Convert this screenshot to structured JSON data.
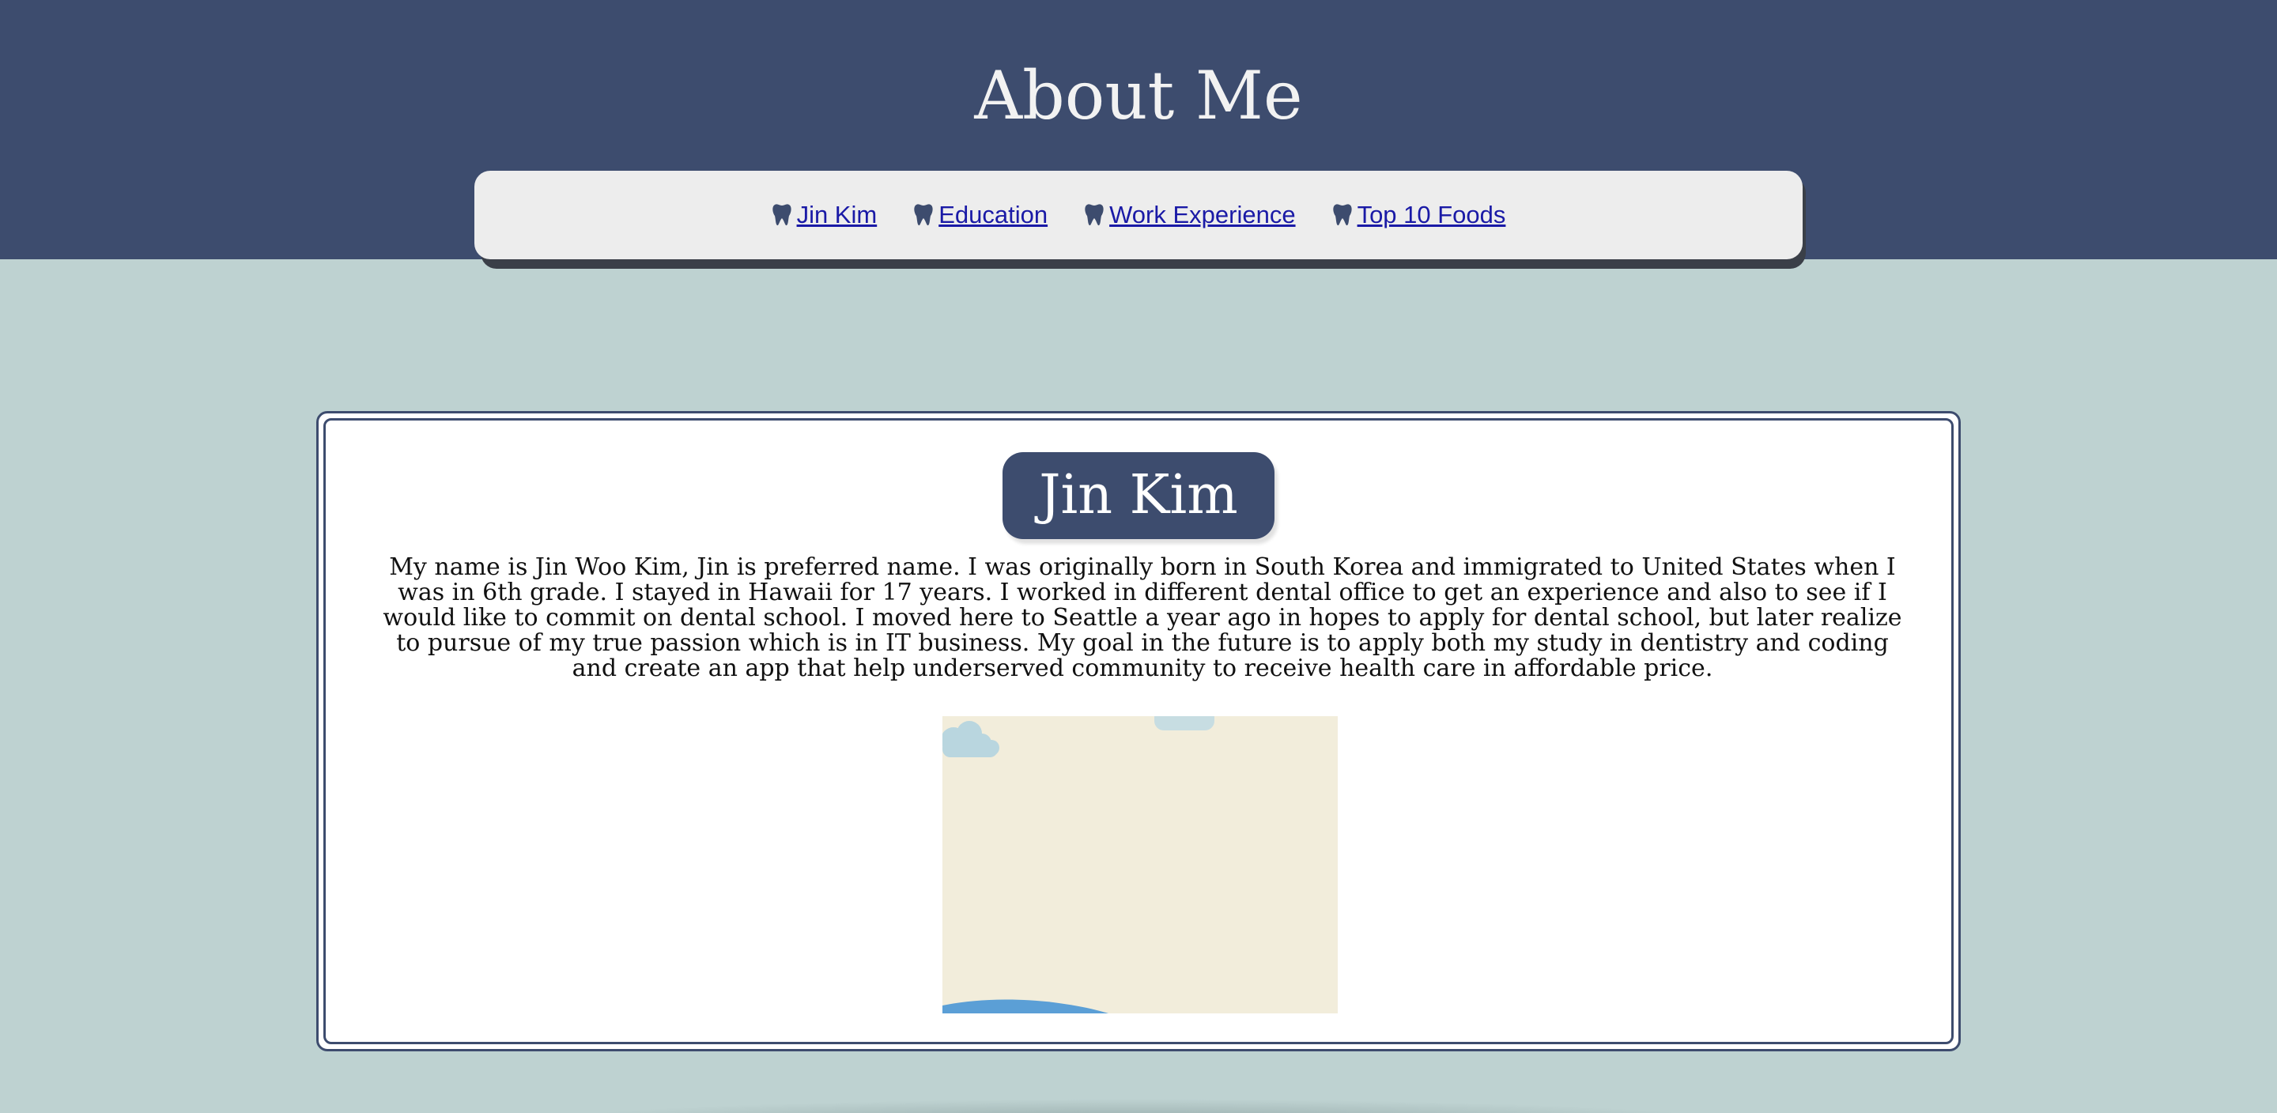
{
  "header": {
    "title": "About Me",
    "background_color": "#3d4c6e"
  },
  "nav": {
    "items": [
      {
        "label": "Jin Kim",
        "icon": "tooth-icon"
      },
      {
        "label": "Education",
        "icon": "tooth-icon"
      },
      {
        "label": "Work Experience",
        "icon": "tooth-icon"
      },
      {
        "label": "Top 10 Foods",
        "icon": "tooth-icon"
      }
    ],
    "link_color": "#1a1aa6"
  },
  "main": {
    "section_title": "Jin Kim",
    "bio": "My name is Jin Woo Kim, Jin is preferred name. I was originally born in South Korea and immigrated to United States when I was in 6th grade. I stayed in Hawaii for 17 years. I worked in different dental office to get an experience and also to see if I would like to commit on dental school. I moved here to Seattle a year ago in hopes to apply for dental school, but later realize to pursue of my true passion which is in IT business. My goal in the future is to apply both my study in dentistry and coding and create an app that help underserved community to receive health care in affordable price.",
    "illustration": {
      "icon": "cartoon-scene-image",
      "background_color": "#f2eddb"
    }
  },
  "colors": {
    "page_background": "#bed2d1",
    "accent": "#3d4c6e",
    "nav_background": "#ededed"
  }
}
